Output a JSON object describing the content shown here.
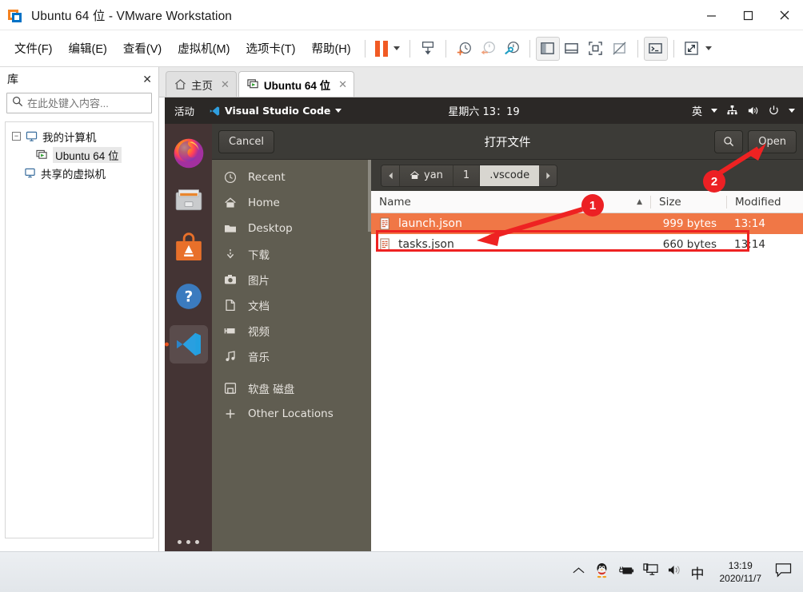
{
  "window": {
    "title": "Ubuntu 64 位 - VMware Workstation",
    "app_icon": "vmware-logo-icon",
    "controls": {
      "minimize": "minimize-icon",
      "maximize": "maximize-icon",
      "close": "close-icon"
    }
  },
  "menubar": {
    "items": [
      {
        "label": "文件(F)",
        "name": "menu-file"
      },
      {
        "label": "编辑(E)",
        "name": "menu-edit"
      },
      {
        "label": "查看(V)",
        "name": "menu-view"
      },
      {
        "label": "虚拟机(M)",
        "name": "menu-vm"
      },
      {
        "label": "选项卡(T)",
        "name": "menu-tabs"
      },
      {
        "label": "帮助(H)",
        "name": "menu-help"
      }
    ],
    "toolbar": [
      {
        "name": "pause-button",
        "icon": "pause-icon"
      },
      {
        "name": "pause-dropdown",
        "icon": "chevron-down-icon"
      },
      {
        "name": "send-ctrl-alt-del-button",
        "icon": "send-key-icon"
      },
      {
        "name": "take-snapshot-button",
        "icon": "snapshot-add-icon"
      },
      {
        "name": "revert-snapshot-button",
        "icon": "snapshot-revert-icon"
      },
      {
        "name": "manage-snapshots-button",
        "icon": "snapshot-manage-icon"
      },
      {
        "name": "show-library-button",
        "icon": "panel-left-icon"
      },
      {
        "name": "show-thumbnail-bar-button",
        "icon": "panel-bottom-icon"
      },
      {
        "name": "full-screen-button",
        "icon": "fullscreen-icon"
      },
      {
        "name": "unity-mode-button",
        "icon": "unity-icon"
      },
      {
        "name": "console-button",
        "icon": "terminal-icon"
      },
      {
        "name": "stretch-button",
        "icon": "expand-arrows-icon"
      },
      {
        "name": "stretch-dropdown",
        "icon": "chevron-down-icon"
      }
    ]
  },
  "library": {
    "title": "库",
    "close_label": "✕",
    "search_placeholder": "在此处键入内容...",
    "search_value": "",
    "tree": [
      {
        "label": "我的计算机",
        "level": 1,
        "expanded": true,
        "icon": "computer-icon",
        "selected": false
      },
      {
        "label": "Ubuntu 64 位",
        "level": 2,
        "icon": "vm-icon",
        "selected": true
      },
      {
        "label": "共享的虚拟机",
        "level": 1,
        "icon": "shared-vm-icon",
        "selected": false
      }
    ]
  },
  "tabs": [
    {
      "label": "主页",
      "icon": "home-icon",
      "active": false,
      "close": "✕"
    },
    {
      "label": "Ubuntu 64 位",
      "icon": "vm-icon",
      "active": true,
      "close": "✕"
    }
  ],
  "ubuntu": {
    "topbar": {
      "activities": "活动",
      "app_name": "Visual Studio Code",
      "app_icon": "vscode-icon",
      "clock": "星期六 13：19",
      "input_method": "英",
      "icons": [
        "network-icon",
        "volume-icon",
        "power-icon"
      ]
    },
    "dock": [
      {
        "name": "firefox",
        "icon": "firefox-icon",
        "active": false
      },
      {
        "name": "files",
        "icon": "files-icon",
        "active": false
      },
      {
        "name": "ubuntu-software",
        "icon": "ubuntu-software-icon",
        "active": false
      },
      {
        "name": "help",
        "icon": "help-icon",
        "active": false
      },
      {
        "name": "visual-studio-code",
        "icon": "vscode-icon",
        "active": true
      }
    ],
    "dock_show_apps": "show-applications-icon"
  },
  "dialog": {
    "title": "打开文件",
    "cancel_label": "Cancel",
    "open_label": "Open",
    "search_icon": "search-icon",
    "pathbar": {
      "back_icon": "chevron-left-icon",
      "forward_icon": "chevron-right-icon",
      "crumbs": [
        {
          "label": "yan",
          "icon": "home-icon",
          "current": false
        },
        {
          "label": "1",
          "icon": "",
          "current": false
        },
        {
          "label": ".vscode",
          "icon": "",
          "current": true
        }
      ]
    },
    "places": [
      {
        "label": "Recent",
        "icon": "clock-icon"
      },
      {
        "label": "Home",
        "icon": "home-icon"
      },
      {
        "label": "Desktop",
        "icon": "folder-icon"
      },
      {
        "label": "下载",
        "icon": "download-icon"
      },
      {
        "label": "图片",
        "icon": "camera-icon"
      },
      {
        "label": "文档",
        "icon": "document-icon"
      },
      {
        "label": "视频",
        "icon": "video-icon"
      },
      {
        "label": "音乐",
        "icon": "music-icon"
      },
      {
        "label": "软盘 磁盘",
        "icon": "floppy-icon"
      },
      {
        "label": "Other Locations",
        "icon": "plus-icon"
      }
    ],
    "columns": {
      "name": "Name",
      "size": "Size",
      "modified": "Modified",
      "sort_indicator": "▲"
    },
    "files": [
      {
        "name": "launch.json",
        "size": "999 bytes",
        "modified": "13:14",
        "icon": "json-file-icon",
        "selected": true
      },
      {
        "name": "tasks.json",
        "size": "660 bytes",
        "modified": "13:14",
        "icon": "json-file-icon",
        "selected": false
      }
    ]
  },
  "annotations": [
    {
      "id": "1",
      "label": "1"
    },
    {
      "id": "2",
      "label": "2"
    }
  ],
  "taskbar": {
    "show_hidden_icon": "chevron-up-icon",
    "tray_icons": [
      "qq-penguin-icon",
      "battery-charging-icon",
      "display-icon",
      "volume-icon"
    ],
    "ime": "中",
    "time": "13:19",
    "date": "2020/11/7",
    "notification_icon": "notification-icon"
  },
  "colors": {
    "accent_orange": "#f07746",
    "annotation_red": "#ee2222",
    "gtk_header": "#3c3b37",
    "places_bg": "#605d51",
    "ubuntu_topbar": "#2b2826",
    "dock_bg": "#3c2f2f"
  }
}
